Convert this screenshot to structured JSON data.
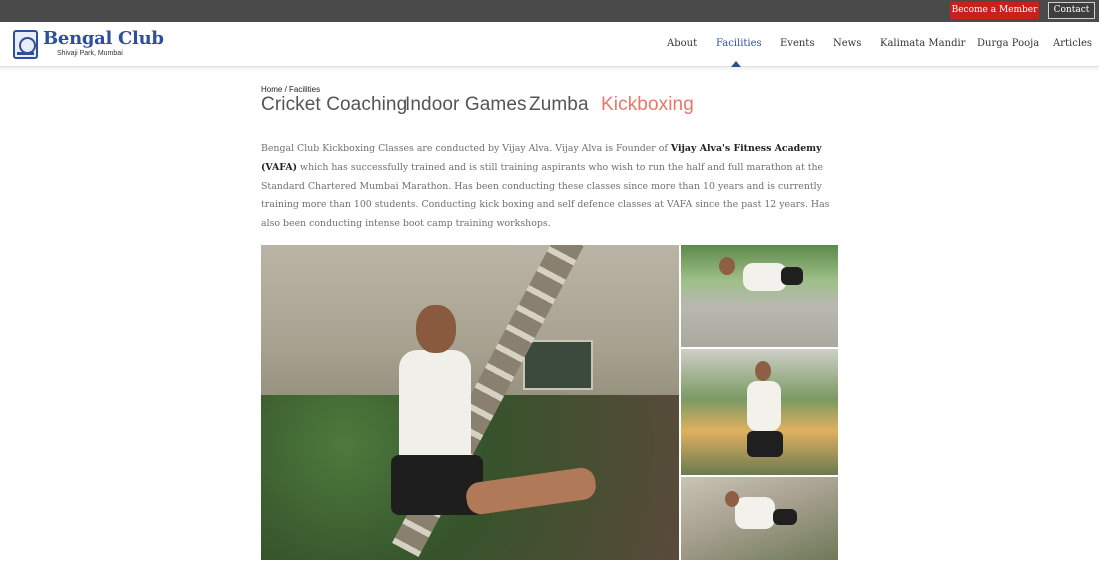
{
  "topbar": {
    "member_label": "Become a Member",
    "contact_label": "Contact"
  },
  "header": {
    "logo_title": "Bengal Club",
    "logo_subtitle": "Shivaji Park, Mumbai",
    "nav": [
      "About",
      "Facilities",
      "Events",
      "News",
      "Kalimata Mandir",
      "Durga Pooja",
      "Articles"
    ],
    "active_nav": "Facilities"
  },
  "breadcrumb": {
    "home": "Home",
    "separator": " / ",
    "current": "Facilities"
  },
  "tabs": [
    "Cricket Coaching",
    "Indoor Games",
    "Zumba",
    "Kickboxing"
  ],
  "active_tab": "Kickboxing",
  "description": {
    "part1": "Bengal Club Kickboxing Classes are conducted by Vijay Alva. Vijay Alva is Founder of ",
    "bold": "Vijay Alva's Fitness Academy (VAFA)",
    "part2": " which has successfully trained and is still training aspirants who wish to run the half and full marathon at the Standard Chartered Mumbai Marathon. Has been conducting these classes since more than 10 years and is currently training more than 100 students. Conducting kick boxing and self defence classes at VAFA since the past 12 years. Has also been conducting intense boot camp training workshops."
  },
  "colors": {
    "accent": "#2f4f9a",
    "member_button": "#c8211d",
    "active_tab": "#e8776a",
    "topbar": "#4a4a4a"
  }
}
